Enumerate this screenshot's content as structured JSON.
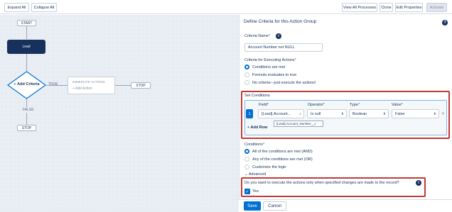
{
  "toolbar": {
    "expand_all": "Expand All",
    "collapse_all": "Collapse All",
    "view_all_processes": "View All Processes",
    "clone": "Clone",
    "edit_properties": "Edit Properties",
    "activate": "Activate"
  },
  "canvas": {
    "start": "START",
    "lead": "Lead",
    "add_criteria": "Add Criteria",
    "true_label": "TRUE",
    "false_label": "FALSE",
    "immediate_actions": "IMMEDIATE ACTIONS",
    "add_action": "Add Action",
    "stop_right": "STOP",
    "stop_bottom": "STOP"
  },
  "panel": {
    "title": "Define Criteria for this Action Group",
    "criteria_name_label": "Criteria Name",
    "criteria_name_value": "Account Number not NULL",
    "criteria_exec_label": "Criteria for Executing Actions",
    "exec_options": [
      "Conditions are met",
      "Formula evaluates to true",
      "No criteria—just execute the actions!"
    ],
    "set_conditions_label": "Set Conditions",
    "col_field": "Field",
    "col_operator": "Operator",
    "col_type": "Type",
    "col_value": "Value",
    "row_number": "1",
    "row_field": "[Lead].Account...",
    "row_operator": "Is null",
    "row_type": "Boolean",
    "row_value": "False",
    "tooltip": "[Lead].Account_Number__c",
    "add_row": "Add Row",
    "conditions_label": "Conditions",
    "condition_options": [
      "All of the conditions are met (AND)",
      "Any of the conditions are met (OR)",
      "Customize the logic"
    ],
    "advanced": "Advanced",
    "changes_question": "Do you want to execute the actions only when specified changes are made to the record?",
    "yes_label": "Yes",
    "save": "Save",
    "cancel": "Cancel"
  },
  "colors": {
    "accent": "#0070d2",
    "navy": "#16325c",
    "highlight": "#c23934"
  }
}
